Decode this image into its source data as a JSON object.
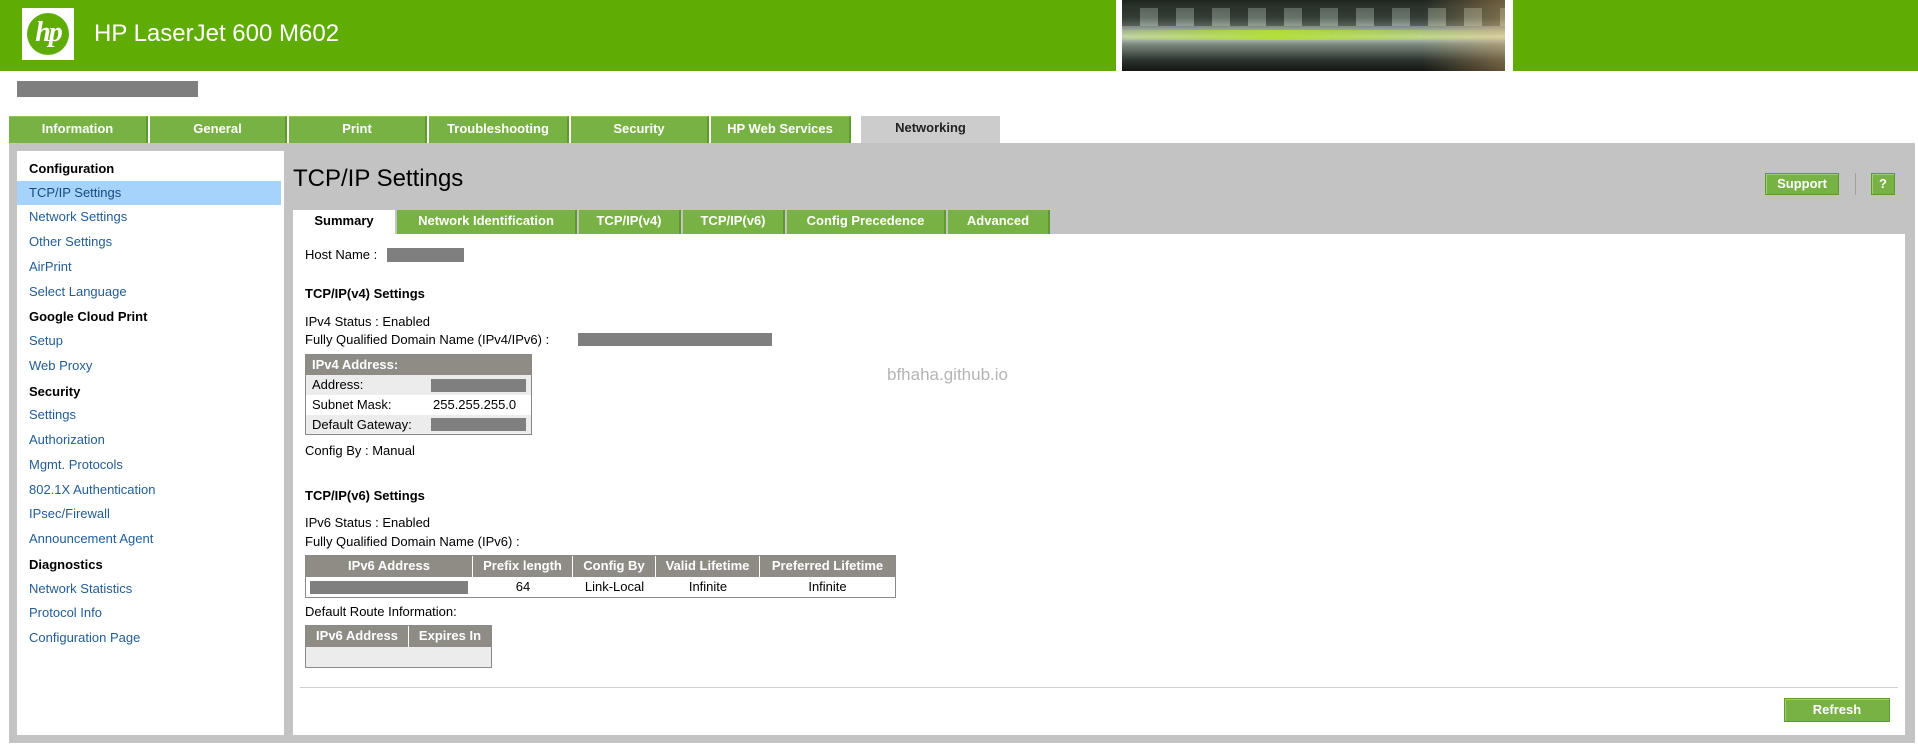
{
  "header": {
    "logo_text": "hp",
    "title": "HP LaserJet 600 M602"
  },
  "main_tabs": [
    {
      "label": "Information"
    },
    {
      "label": "General"
    },
    {
      "label": "Print"
    },
    {
      "label": "Troubleshooting"
    },
    {
      "label": "Security"
    },
    {
      "label": "HP Web Services"
    },
    {
      "label": "Networking"
    }
  ],
  "sidebar": {
    "sections": [
      {
        "heading": "Configuration",
        "items": [
          "TCP/IP Settings",
          "Network Settings",
          "Other Settings",
          "AirPrint",
          "Select Language"
        ]
      },
      {
        "heading": "Google Cloud Print",
        "items": [
          "Setup",
          "Web Proxy"
        ]
      },
      {
        "heading": "Security",
        "items": [
          "Settings",
          "Authorization",
          "Mgmt. Protocols",
          "802.1X Authentication",
          "IPsec/Firewall",
          "Announcement Agent"
        ]
      },
      {
        "heading": "Diagnostics",
        "items": [
          "Network Statistics",
          "Protocol Info",
          "Configuration Page"
        ]
      }
    ],
    "active_item": "TCP/IP Settings"
  },
  "page": {
    "title": "TCP/IP Settings",
    "support_label": "Support",
    "help_label": "?",
    "refresh_label": "Refresh"
  },
  "sub_tabs": [
    {
      "label": "Summary"
    },
    {
      "label": "Network Identification"
    },
    {
      "label": "TCP/IP(v4)"
    },
    {
      "label": "TCP/IP(v6)"
    },
    {
      "label": "Config Precedence"
    },
    {
      "label": "Advanced"
    }
  ],
  "summary": {
    "host_name_label": "Host Name :",
    "v4_heading": "TCP/IP(v4) Settings",
    "ipv4_status": "IPv4 Status : Enabled",
    "fqdn_v4v6_label": "Fully Qualified Domain Name (IPv4/IPv6) :",
    "ipv4_table": {
      "header": "IPv4 Address:",
      "rows": [
        {
          "label": "Address:",
          "value": ""
        },
        {
          "label": "Subnet Mask:",
          "value": "255.255.255.0"
        },
        {
          "label": "Default Gateway:",
          "value": ""
        }
      ]
    },
    "config_by": "Config By : Manual",
    "v6_heading": "TCP/IP(v6) Settings",
    "ipv6_status": "IPv6 Status : Enabled",
    "fqdn_v6_label": "Fully Qualified Domain Name (IPv6) :",
    "ipv6_table": {
      "headers": [
        "IPv6 Address",
        "Prefix length",
        "Config By",
        "Valid Lifetime",
        "Preferred Lifetime"
      ],
      "rows": [
        {
          "address": "",
          "prefix": "64",
          "config_by": "Link-Local",
          "valid": "Infinite",
          "preferred": "Infinite"
        }
      ]
    },
    "default_route_label": "Default Route Information:",
    "route_table": {
      "headers": [
        "IPv6 Address",
        "Expires In"
      ]
    }
  },
  "watermark": "bfhaha.github.io",
  "colors": {
    "brand_green": "#5fac05",
    "tab_green": "#78b144",
    "active_tab_gray": "#cccccc",
    "sidebar_active": "#a6d3fb",
    "link_blue": "#225d96",
    "table_header": "#8f8c86"
  }
}
